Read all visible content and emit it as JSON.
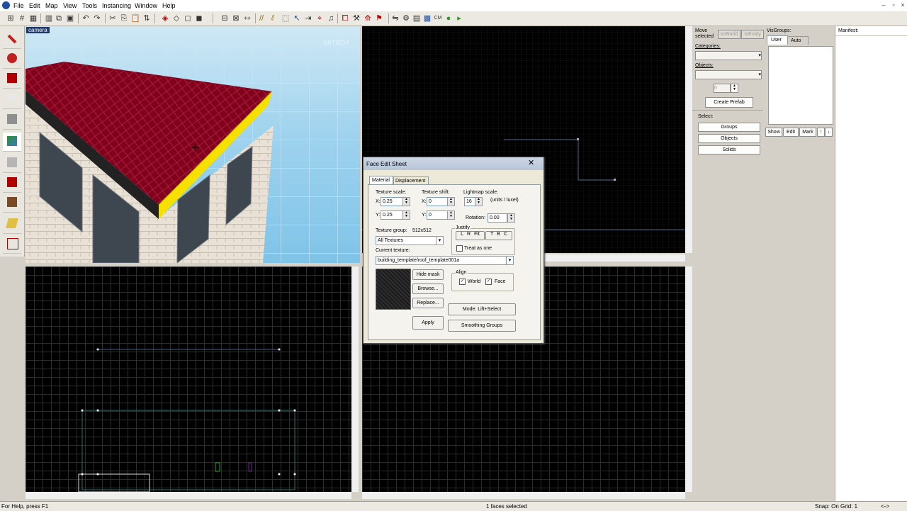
{
  "menubar": {
    "items": [
      "File",
      "Edit",
      "Map",
      "View",
      "Tools",
      "Instancing",
      "Window",
      "Help"
    ]
  },
  "viewports": {
    "camera_label": "camera",
    "watermark": "SKYBOX"
  },
  "face_edit": {
    "title": "Face Edit Sheet",
    "tabs": [
      "Material",
      "Displacement"
    ],
    "texture_scale_label": "Texture scale:",
    "texture_shift_label": "Texture shift:",
    "lightmap_scale_label": "Lightmap scale:",
    "lightmap_units": "(units / luxel)",
    "scale_x": "0.25",
    "scale_y": "0.25",
    "shift_x": "0",
    "shift_y": "0",
    "lightmap_value": "16",
    "rotation_label": "Rotation:",
    "rotation_value": "0.00",
    "x_label": "X:",
    "y_label": "Y:",
    "justify_label": "Justify",
    "justify_buttons": [
      "L",
      "R",
      "Fit",
      "T",
      "B",
      "C"
    ],
    "treat_as_one": "Treat as one",
    "texture_group_label": "Texture group:",
    "texture_size": "512x512",
    "texture_group_value": "All Textures",
    "current_texture_label": "Current texture:",
    "current_texture_value": "building_template/roof_template001a",
    "hide_mask": "Hide mask",
    "browse": "Browse...",
    "replace": "Replace...",
    "apply": "Apply",
    "align_label": "Align",
    "align_world": "World",
    "align_face": "Face",
    "mode": "Mode: Lift+Select",
    "smoothing": "Smoothing Groups"
  },
  "rpanel": {
    "move_selected": "Move selected",
    "to_world": "toWorld",
    "to_entity": "toEntity",
    "categories_label": "Categories:",
    "objects_label": "Objects:",
    "count_value": "0",
    "create_prefab": "Create Prefab",
    "select_label": "Select:",
    "select_buttons": [
      "Groups",
      "Objects",
      "Solids"
    ],
    "visgroups_label": "VisGroups:",
    "visgroup_tabs": [
      "User",
      "Auto"
    ],
    "visgroup_buttons": [
      "Show",
      "Edit",
      "Mark"
    ],
    "manifest_label": "Manifest:"
  },
  "status": {
    "help": "For Help, press F1",
    "selection": "1 faces selected",
    "snap": "Snap: On Grid: 1",
    "arrows": "<->"
  },
  "colors": {
    "roof": "#7a0019",
    "roof_edge": "#f5e000",
    "sky": "#9fd3ee",
    "grid": "#2a2a2a"
  }
}
